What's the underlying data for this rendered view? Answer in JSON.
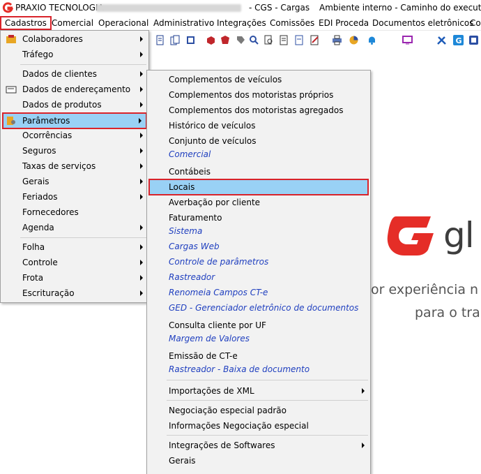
{
  "titlebar": {
    "company": "PRAXIO TECNOLOGIA",
    "app": "- CGS - Cargas",
    "environment": "Ambiente interno - Caminho do executável"
  },
  "menubar": {
    "items": [
      "Cadastros",
      "Comercial",
      "Operacional",
      "Administrativo",
      "Integrações",
      "Comissões",
      "EDI Proceda",
      "Documentos eletrônicos",
      "Co"
    ]
  },
  "menu_cadastros": {
    "items": [
      "Colaboradores",
      "Tráfego",
      "Dados de clientes",
      "Dados de endereçamento",
      "Dados de produtos",
      "Parâmetros",
      "Ocorrências",
      "Seguros",
      "Taxas de serviços",
      "Gerais",
      "Feriados",
      "Fornecedores",
      "Agenda",
      "Folha",
      "Controle",
      "Frota",
      "Escrituração"
    ]
  },
  "menu_parametros": {
    "items": [
      "Complementos de veículos",
      "Complementos dos motoristas próprios",
      "Complementos dos motoristas agregados",
      "Histórico de veículos",
      "Conjunto de veículos",
      "Comercial",
      "Contábeis",
      "Locais",
      "Averbação por cliente",
      "Faturamento",
      "Sistema",
      "Cargas Web",
      "Controle de parâmetros",
      "Rastreador",
      "Renomeia Campos CT-e",
      "GED - Gerenciador eletrônico de documentos",
      "Consulta cliente por UF",
      "Margem de Valores",
      "Emissão de CT-e",
      "Rastreador - Baixa de documento",
      "Importações de XML",
      "Negociação especial padrão",
      "Informações Negociação especial",
      "Integrações de Softwares",
      "Gerais"
    ]
  },
  "splash": {
    "brand": "gl",
    "line1": "or experiência n",
    "line2": "para o tra"
  },
  "colors": {
    "highlight": "#99d1f5",
    "outline": "#d9232a",
    "menu_bg": "#f2f2f2",
    "link": "#1f3fbf",
    "brand_red": "#e52d27"
  }
}
